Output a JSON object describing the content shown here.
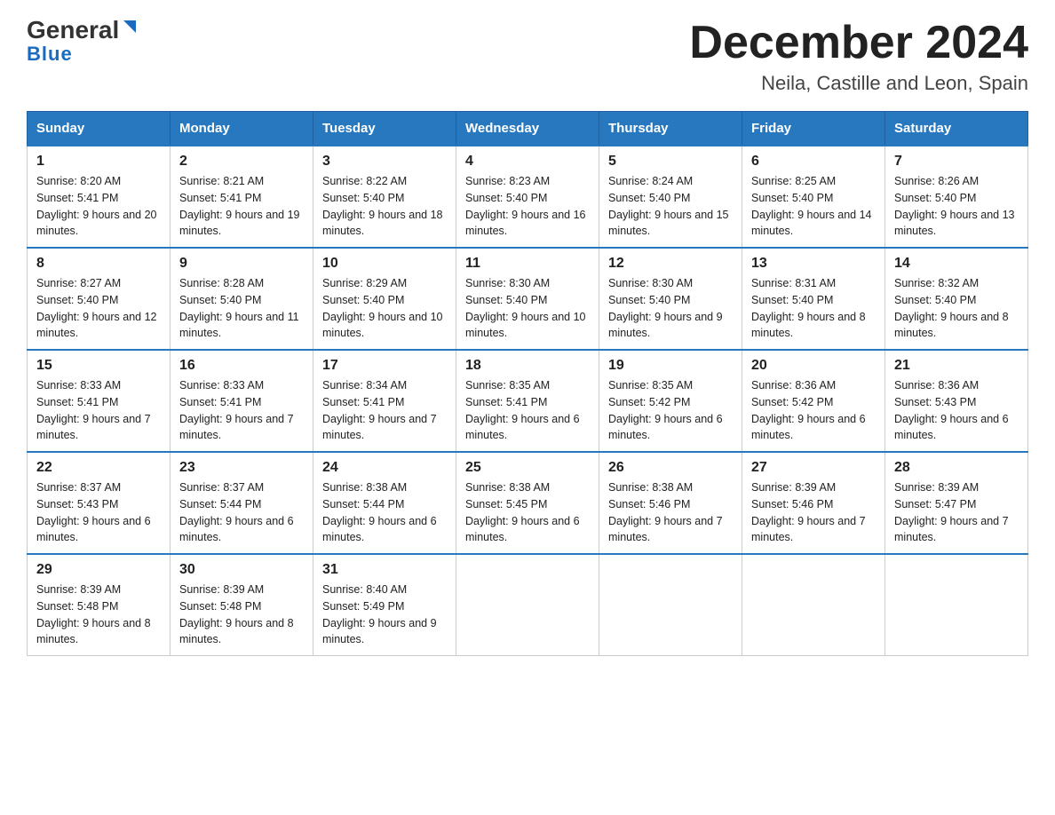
{
  "header": {
    "logo_general": "General",
    "logo_blue": "Blue",
    "month_year": "December 2024",
    "location": "Neila, Castille and Leon, Spain"
  },
  "days_of_week": [
    "Sunday",
    "Monday",
    "Tuesday",
    "Wednesday",
    "Thursday",
    "Friday",
    "Saturday"
  ],
  "weeks": [
    [
      {
        "day": "1",
        "sunrise": "8:20 AM",
        "sunset": "5:41 PM",
        "daylight": "9 hours and 20 minutes."
      },
      {
        "day": "2",
        "sunrise": "8:21 AM",
        "sunset": "5:41 PM",
        "daylight": "9 hours and 19 minutes."
      },
      {
        "day": "3",
        "sunrise": "8:22 AM",
        "sunset": "5:40 PM",
        "daylight": "9 hours and 18 minutes."
      },
      {
        "day": "4",
        "sunrise": "8:23 AM",
        "sunset": "5:40 PM",
        "daylight": "9 hours and 16 minutes."
      },
      {
        "day": "5",
        "sunrise": "8:24 AM",
        "sunset": "5:40 PM",
        "daylight": "9 hours and 15 minutes."
      },
      {
        "day": "6",
        "sunrise": "8:25 AM",
        "sunset": "5:40 PM",
        "daylight": "9 hours and 14 minutes."
      },
      {
        "day": "7",
        "sunrise": "8:26 AM",
        "sunset": "5:40 PM",
        "daylight": "9 hours and 13 minutes."
      }
    ],
    [
      {
        "day": "8",
        "sunrise": "8:27 AM",
        "sunset": "5:40 PM",
        "daylight": "9 hours and 12 minutes."
      },
      {
        "day": "9",
        "sunrise": "8:28 AM",
        "sunset": "5:40 PM",
        "daylight": "9 hours and 11 minutes."
      },
      {
        "day": "10",
        "sunrise": "8:29 AM",
        "sunset": "5:40 PM",
        "daylight": "9 hours and 10 minutes."
      },
      {
        "day": "11",
        "sunrise": "8:30 AM",
        "sunset": "5:40 PM",
        "daylight": "9 hours and 10 minutes."
      },
      {
        "day": "12",
        "sunrise": "8:30 AM",
        "sunset": "5:40 PM",
        "daylight": "9 hours and 9 minutes."
      },
      {
        "day": "13",
        "sunrise": "8:31 AM",
        "sunset": "5:40 PM",
        "daylight": "9 hours and 8 minutes."
      },
      {
        "day": "14",
        "sunrise": "8:32 AM",
        "sunset": "5:40 PM",
        "daylight": "9 hours and 8 minutes."
      }
    ],
    [
      {
        "day": "15",
        "sunrise": "8:33 AM",
        "sunset": "5:41 PM",
        "daylight": "9 hours and 7 minutes."
      },
      {
        "day": "16",
        "sunrise": "8:33 AM",
        "sunset": "5:41 PM",
        "daylight": "9 hours and 7 minutes."
      },
      {
        "day": "17",
        "sunrise": "8:34 AM",
        "sunset": "5:41 PM",
        "daylight": "9 hours and 7 minutes."
      },
      {
        "day": "18",
        "sunrise": "8:35 AM",
        "sunset": "5:41 PM",
        "daylight": "9 hours and 6 minutes."
      },
      {
        "day": "19",
        "sunrise": "8:35 AM",
        "sunset": "5:42 PM",
        "daylight": "9 hours and 6 minutes."
      },
      {
        "day": "20",
        "sunrise": "8:36 AM",
        "sunset": "5:42 PM",
        "daylight": "9 hours and 6 minutes."
      },
      {
        "day": "21",
        "sunrise": "8:36 AM",
        "sunset": "5:43 PM",
        "daylight": "9 hours and 6 minutes."
      }
    ],
    [
      {
        "day": "22",
        "sunrise": "8:37 AM",
        "sunset": "5:43 PM",
        "daylight": "9 hours and 6 minutes."
      },
      {
        "day": "23",
        "sunrise": "8:37 AM",
        "sunset": "5:44 PM",
        "daylight": "9 hours and 6 minutes."
      },
      {
        "day": "24",
        "sunrise": "8:38 AM",
        "sunset": "5:44 PM",
        "daylight": "9 hours and 6 minutes."
      },
      {
        "day": "25",
        "sunrise": "8:38 AM",
        "sunset": "5:45 PM",
        "daylight": "9 hours and 6 minutes."
      },
      {
        "day": "26",
        "sunrise": "8:38 AM",
        "sunset": "5:46 PM",
        "daylight": "9 hours and 7 minutes."
      },
      {
        "day": "27",
        "sunrise": "8:39 AM",
        "sunset": "5:46 PM",
        "daylight": "9 hours and 7 minutes."
      },
      {
        "day": "28",
        "sunrise": "8:39 AM",
        "sunset": "5:47 PM",
        "daylight": "9 hours and 7 minutes."
      }
    ],
    [
      {
        "day": "29",
        "sunrise": "8:39 AM",
        "sunset": "5:48 PM",
        "daylight": "9 hours and 8 minutes."
      },
      {
        "day": "30",
        "sunrise": "8:39 AM",
        "sunset": "5:48 PM",
        "daylight": "9 hours and 8 minutes."
      },
      {
        "day": "31",
        "sunrise": "8:40 AM",
        "sunset": "5:49 PM",
        "daylight": "9 hours and 9 minutes."
      },
      null,
      null,
      null,
      null
    ]
  ]
}
